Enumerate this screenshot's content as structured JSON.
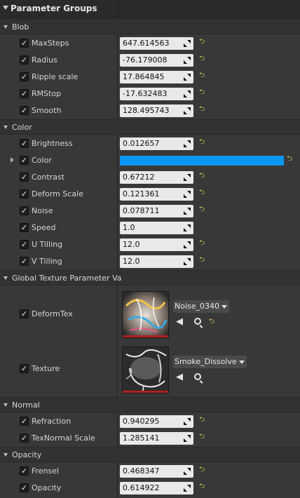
{
  "header": {
    "title": "Parameter Groups"
  },
  "categories": {
    "blob": "Blob",
    "color": "Color",
    "global_texture": "Global Texture Parameter Va",
    "normal": "Normal",
    "opacity": "Opacity"
  },
  "params": {
    "maxsteps": {
      "name": "MaxSteps",
      "value": "647.614563"
    },
    "radius": {
      "name": "Radius",
      "value": "-76.179008"
    },
    "ripple_scale": {
      "name": "Ripple scale",
      "value": "17.864845"
    },
    "rmstop": {
      "name": "RMStop",
      "value": "-17.632483"
    },
    "smooth": {
      "name": "Smooth",
      "value": "128.495743"
    },
    "brightness": {
      "name": "Brightness",
      "value": "0.012657"
    },
    "color": {
      "name": "Color",
      "swatch": "#0A96F0"
    },
    "contrast": {
      "name": "Contrast",
      "value": "0.67212"
    },
    "deform_scale": {
      "name": "Deform Scale",
      "value": "0.121361"
    },
    "noise": {
      "name": "Noise",
      "value": "0.078711"
    },
    "speed": {
      "name": "Speed",
      "value": "1.0"
    },
    "u_tilling": {
      "name": "U Tilling",
      "value": "12.0"
    },
    "v_tilling": {
      "name": "V Tilling",
      "value": "12.0"
    },
    "deformtex": {
      "name": "DeformTex",
      "asset": "Noise_0340"
    },
    "texture": {
      "name": "Texture",
      "asset": "Smoke_Dissolve"
    },
    "refraction": {
      "name": "Refraction",
      "value": "0.940295"
    },
    "texnormal_scale": {
      "name": "TexNormal Scale",
      "value": "1.285141"
    },
    "frensel": {
      "name": "Frensel",
      "value": "0.468347"
    },
    "opacity": {
      "name": "Opacity",
      "value": "0.614922"
    }
  },
  "icons": {
    "checkbox": "checkmark-icon",
    "reset": "reset-to-default-icon",
    "drag": "drag-grip-icon",
    "use_asset": "use-selected-arrow-icon",
    "browse": "browse-search-icon",
    "dropdown": "chevron-down-icon"
  },
  "colors": {
    "reset_icon": "#E0D84A",
    "color_swatch": "#0A96F0",
    "thumb_border": "#B02020"
  }
}
